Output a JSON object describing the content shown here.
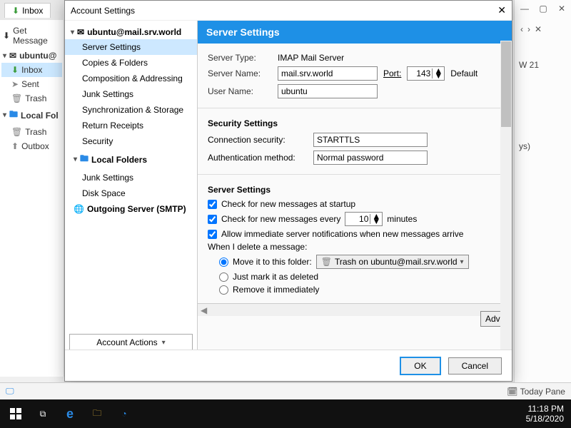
{
  "bg": {
    "tab": "Inbox",
    "getmsg": "Get Message",
    "tree": {
      "acct": "ubuntu@",
      "inbox": "Inbox",
      "sent": "Sent",
      "trash": "Trash",
      "local": "Local Fol",
      "ltrash": "Trash",
      "outbox": "Outbox"
    },
    "rightfrag1": "W 21",
    "rightfrag2": "ys)"
  },
  "dialog": {
    "title": "Account Settings",
    "nav": {
      "acct": "ubuntu@mail.srv.world",
      "items": [
        "Server Settings",
        "Copies & Folders",
        "Composition & Addressing",
        "Junk Settings",
        "Synchronization & Storage",
        "Return Receipts",
        "Security"
      ],
      "local": "Local Folders",
      "localitems": [
        "Junk Settings",
        "Disk Space"
      ],
      "smtp": "Outgoing Server (SMTP)",
      "acctactions": "Account Actions"
    },
    "hdr": "Server Settings",
    "server": {
      "typelbl": "Server Type:",
      "type": "IMAP Mail Server",
      "namelbl": "Server Name:",
      "name": "mail.srv.world",
      "portlbl": "Port:",
      "port": "143",
      "default": "Default",
      "userlbl": "User Name:",
      "user": "ubuntu"
    },
    "security": {
      "title": "Security Settings",
      "connlbl": "Connection security:",
      "conn": "STARTTLS",
      "authlbl": "Authentication method:",
      "auth": "Normal password"
    },
    "settings": {
      "title": "Server Settings",
      "chk1": "Check for new messages at startup",
      "chk2a": "Check for new messages every",
      "interval": "10",
      "chk2b": "minutes",
      "chk3": "Allow immediate server notifications when new messages arrive",
      "deletelbl": "When I delete a message:",
      "r1": "Move it to this folder:",
      "folder": "Trash on ubuntu@mail.srv.world",
      "r2": "Just mark it as deleted",
      "r3": "Remove it immediately"
    },
    "adv": "Advan",
    "ok": "OK",
    "cancel": "Cancel"
  },
  "status": {
    "left": "",
    "mid": "",
    "today": "Today Pane"
  },
  "clock": {
    "time": "11:18 PM",
    "date": "5/18/2020"
  }
}
